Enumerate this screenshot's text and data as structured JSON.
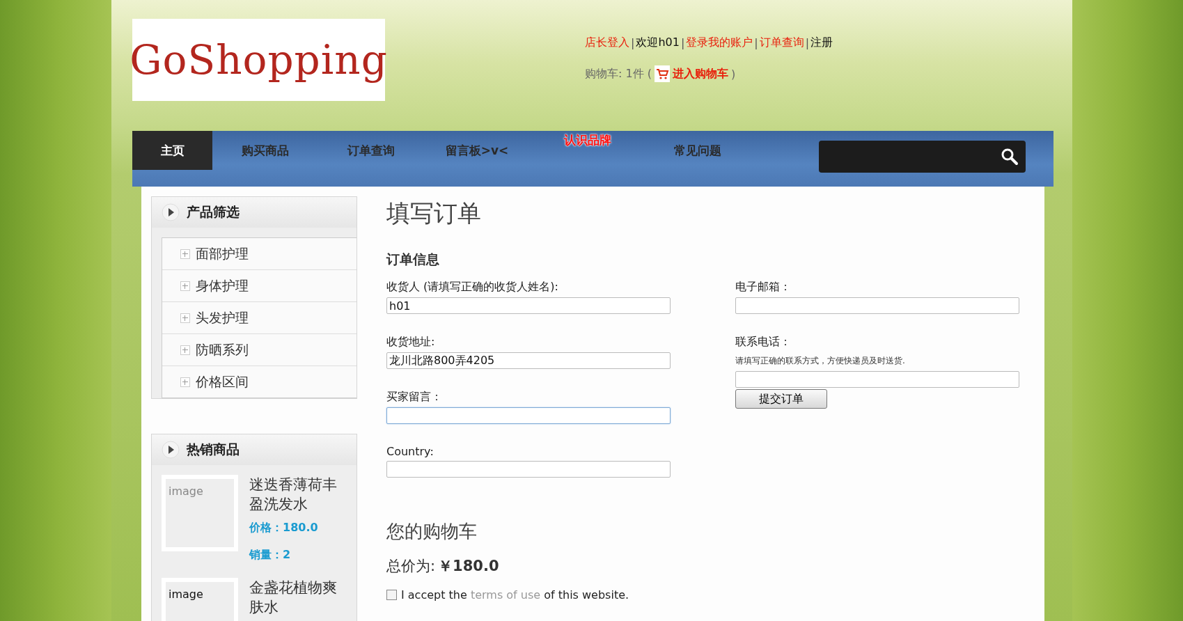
{
  "header": {
    "logo": "GoShopping",
    "top_links": [
      {
        "text": "店长登入",
        "kind": "link"
      },
      {
        "text": "|",
        "kind": "sep"
      },
      {
        "text": "欢迎h01",
        "kind": "text"
      },
      {
        "text": "|",
        "kind": "sep"
      },
      {
        "text": "登录我的账户",
        "kind": "link"
      },
      {
        "text": "|",
        "kind": "sep"
      },
      {
        "text": "订单查询",
        "kind": "link"
      },
      {
        "text": "|",
        "kind": "sep"
      },
      {
        "text": "注册",
        "kind": "text"
      }
    ],
    "cart": {
      "label": "购物车: 1件 (",
      "link": "进入购物车",
      "close": ")"
    }
  },
  "nav": {
    "tabs": [
      {
        "label": "主页",
        "selected": true,
        "kind": "normal"
      },
      {
        "label": "购买商品",
        "selected": false,
        "kind": "normal"
      },
      {
        "label": "订单查询",
        "selected": false,
        "kind": "normal"
      },
      {
        "label": "留言板>v<",
        "selected": false,
        "kind": "normal"
      },
      {
        "label": "认识品牌",
        "selected": false,
        "kind": "featured"
      },
      {
        "label": "常见问题",
        "selected": false,
        "kind": "normal"
      }
    ]
  },
  "sidebar": {
    "filter": {
      "title": "产品筛选",
      "items": [
        {
          "label": "面部护理",
          "expanded": false
        },
        {
          "label": "身体护理",
          "expanded": false
        },
        {
          "label": "头发护理",
          "expanded": false
        },
        {
          "label": "防晒系列",
          "expanded": false
        },
        {
          "label": "价格区间",
          "expanded": false
        }
      ]
    },
    "hot": {
      "title": "热销商品",
      "products": [
        {
          "image": "image",
          "name": "迷迭香薄荷丰盈洗发水",
          "price_label": "价格：",
          "price": "180.0",
          "sales_label": "销量：",
          "sales": "2"
        },
        {
          "image": "image",
          "name": "金盏花植物爽肤水"
        }
      ]
    }
  },
  "main": {
    "title": "填写订单",
    "section": "订单信息",
    "left_fields": [
      {
        "label": "收货人 (请填写正确的收货人姓名):",
        "value": "h01",
        "focused": false
      },
      {
        "label": "收货地址:",
        "value": "龙川北路800弄4205",
        "focused": false
      },
      {
        "label": "买家留言：",
        "focused": true
      },
      {
        "label": "Country:",
        "focused": false
      }
    ],
    "right_fields": [
      {
        "label": "电子邮箱：",
        "focused": false
      },
      {
        "label": "联系电话：",
        "hint": "请填写正确的联系方式，方便快递员及时送货.",
        "focused": false
      }
    ],
    "submit": "提交订单",
    "cart": {
      "title": "您的购物车",
      "total_label": "总价为:",
      "total": "￥180.0"
    },
    "terms": {
      "checked": false,
      "before": "I accept the",
      "link": "terms of use",
      "after": "of this website."
    }
  }
}
